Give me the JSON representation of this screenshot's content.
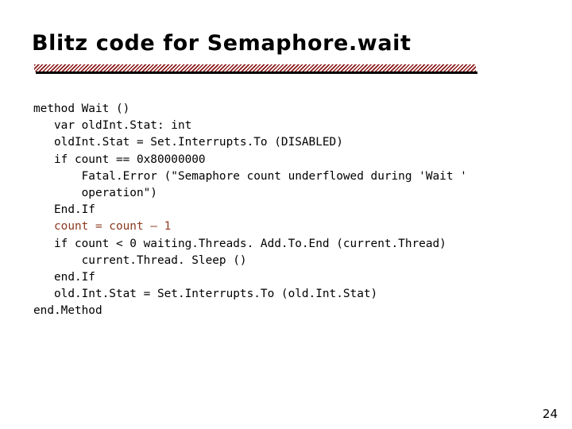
{
  "slide": {
    "title": "Blitz code for Semaphore.wait",
    "page_number": "24",
    "accent_color": "#8c3a20",
    "rule_color": "#8b1a1a",
    "text_color": "#000000",
    "background_color": "#ffffff"
  },
  "code": {
    "lines": [
      {
        "text": "method Wait ()",
        "color": "default"
      },
      {
        "text": "   var oldInt.Stat: int",
        "color": "default"
      },
      {
        "text": "   oldInt.Stat = Set.Interrupts.To (DISABLED)",
        "color": "default"
      },
      {
        "text": "   if count == 0x80000000",
        "color": "default"
      },
      {
        "text": "       Fatal.Error (\"Semaphore count underflowed during 'Wait '",
        "color": "default"
      },
      {
        "text": "       operation\")",
        "color": "default"
      },
      {
        "text": "   End.If",
        "color": "default"
      },
      {
        "text": "   count = count – 1",
        "color": "accent"
      },
      {
        "text": "   if count < 0 waiting.Threads. Add.To.End (current.Thread)",
        "color": "default"
      },
      {
        "text": "       current.Thread. Sleep ()",
        "color": "default"
      },
      {
        "text": "   end.If",
        "color": "default"
      },
      {
        "text": "   old.Int.Stat = Set.Interrupts.To (old.Int.Stat)",
        "color": "default"
      },
      {
        "text": "end.Method",
        "color": "default"
      }
    ]
  }
}
